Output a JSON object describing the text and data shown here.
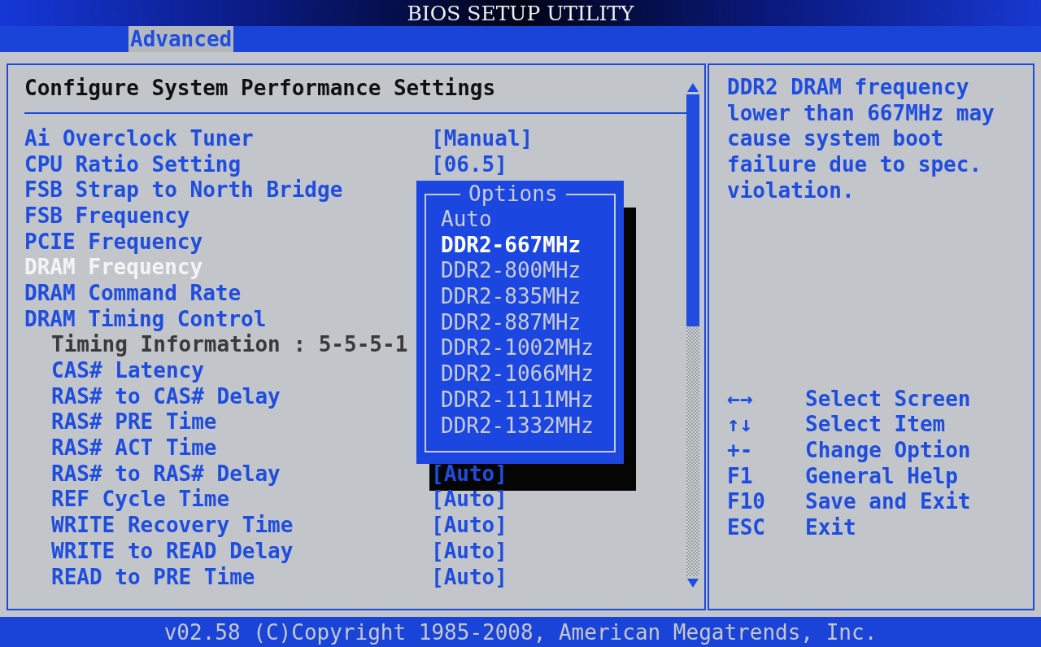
{
  "window": {
    "title": "BIOS SETUP UTILITY"
  },
  "tabs": [
    {
      "label": "Advanced",
      "selected": true
    }
  ],
  "panel": {
    "heading": "Configure System Performance Settings",
    "items": [
      {
        "name": "Ai Overclock Tuner",
        "value": "[Manual]",
        "selected": false
      },
      {
        "name": "CPU Ratio Setting",
        "value": "[06.5]",
        "selected": false
      },
      {
        "name": "FSB Strap to North Bridge",
        "selected": false
      },
      {
        "name": "FSB Frequency",
        "selected": false
      },
      {
        "name": "PCIE Frequency",
        "selected": false
      },
      {
        "name": "DRAM Frequency",
        "selected": true
      },
      {
        "name": "DRAM Command Rate",
        "selected": false
      },
      {
        "name": "DRAM Timing Control",
        "selected": false,
        "children": [
          {
            "kind": "info",
            "name": "Timing Information : 5-5-5-1",
            "selected": false
          },
          {
            "kind": "item",
            "name": "CAS# Latency",
            "selected": false
          },
          {
            "kind": "item",
            "name": "RAS# to CAS# Delay",
            "selected": false
          },
          {
            "kind": "item",
            "name": "RAS# PRE Time",
            "selected": false
          },
          {
            "kind": "item",
            "name": "RAS# ACT Time",
            "selected": false
          },
          {
            "kind": "item",
            "name": "RAS# to RAS# Delay",
            "value": "[Auto]",
            "selected": false
          },
          {
            "kind": "item",
            "name": "REF Cycle Time",
            "value": "[Auto]",
            "selected": false
          },
          {
            "kind": "item",
            "name": "WRITE Recovery Time",
            "value": "[Auto]",
            "selected": false
          },
          {
            "kind": "item",
            "name": "WRITE to READ Delay",
            "value": "[Auto]",
            "selected": false
          },
          {
            "kind": "item",
            "name": "READ to PRE Time",
            "value": "[Auto]",
            "selected": false
          }
        ]
      }
    ]
  },
  "popup": {
    "title": "Options",
    "options": [
      {
        "label": "Auto",
        "selected": false
      },
      {
        "label": "DDR2-667MHz",
        "selected": true
      },
      {
        "label": "DDR2-800MHz",
        "selected": false
      },
      {
        "label": "DDR2-835MHz",
        "selected": false
      },
      {
        "label": "DDR2-887MHz",
        "selected": false
      },
      {
        "label": "DDR2-1002MHz",
        "selected": false
      },
      {
        "label": "DDR2-1066MHz",
        "selected": false
      },
      {
        "label": "DDR2-1111MHz",
        "selected": false
      },
      {
        "label": "DDR2-1332MHz",
        "selected": false
      }
    ]
  },
  "help": {
    "text": "DDR2 DRAM frequency lower than 667MHz may cause system boot failure due to spec. violation.",
    "keys": [
      {
        "key": "←→",
        "action": "Select Screen"
      },
      {
        "key": "↑↓",
        "action": "Select Item"
      },
      {
        "key": "+-",
        "action": "Change Option"
      },
      {
        "key": "F1",
        "action": "General Help"
      },
      {
        "key": "F10",
        "action": "Save and Exit"
      },
      {
        "key": "ESC",
        "action": "Exit"
      }
    ]
  },
  "status_bar": "v02.58 (C)Copyright 1985-2008, American Megatrends, Inc."
}
